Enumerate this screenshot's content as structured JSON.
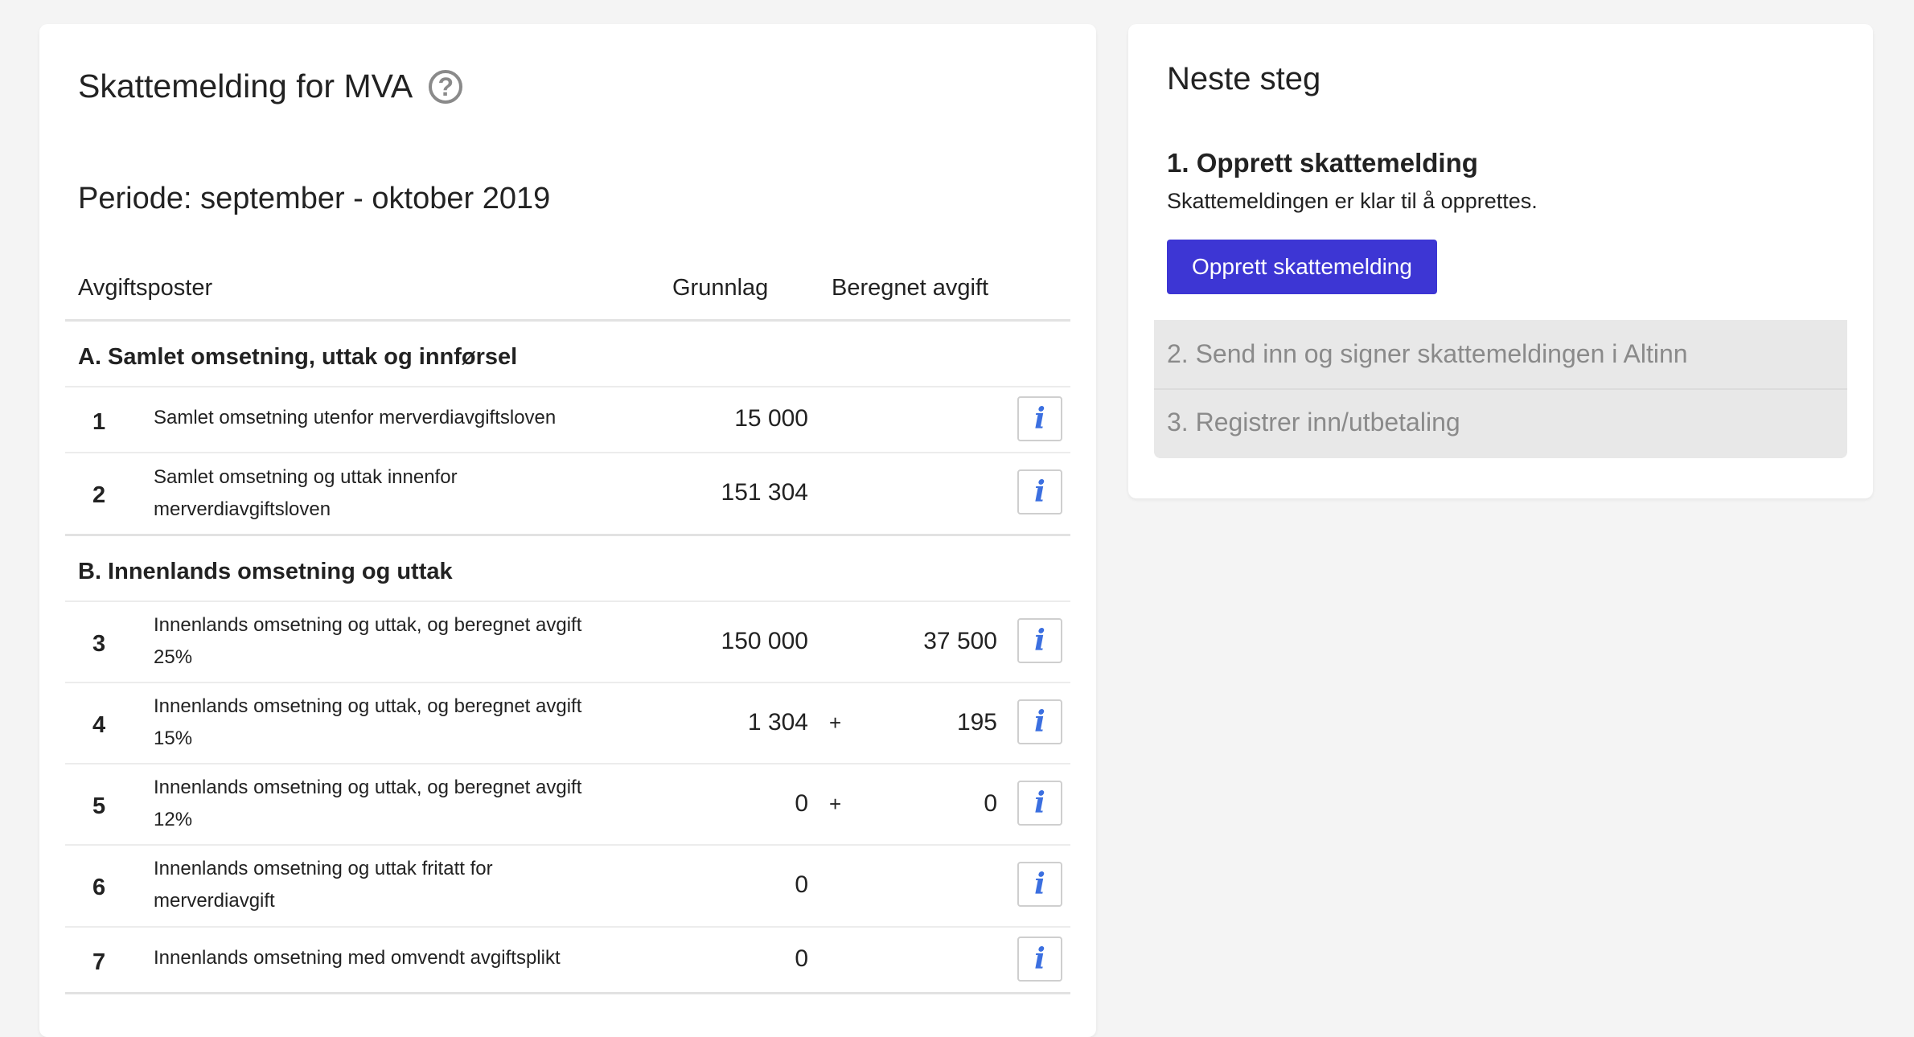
{
  "left": {
    "title": "Skattemelding for MVA",
    "help_icon": "question-circle-icon",
    "period": "Periode: september - oktober 2019",
    "headers": {
      "avgiftsposter": "Avgiftsposter",
      "grunnlag": "Grunnlag",
      "beregnet": "Beregnet avgift"
    },
    "section_a": "A. Samlet omsetning, uttak og innførsel",
    "section_b": "B. Innenlands omsetning og uttak",
    "rows": [
      {
        "num": "1",
        "desc": "Samlet omsetning utenfor merverdiavgiftsloven",
        "grunnlag": "15 000",
        "plus": "",
        "avgift": ""
      },
      {
        "num": "2",
        "desc": "Samlet omsetning og uttak innenfor merverdiavgiftsloven",
        "grunnlag": "151 304",
        "plus": "",
        "avgift": ""
      },
      {
        "num": "3",
        "desc": "Innenlands omsetning og uttak, og beregnet avgift 25%",
        "grunnlag": "150 000",
        "plus": "",
        "avgift": "37 500"
      },
      {
        "num": "4",
        "desc": "Innenlands omsetning og uttak, og beregnet avgift 15%",
        "grunnlag": "1 304",
        "plus": "+",
        "avgift": "195"
      },
      {
        "num": "5",
        "desc": "Innenlands omsetning og uttak, og beregnet avgift 12%",
        "grunnlag": "0",
        "plus": "+",
        "avgift": "0"
      },
      {
        "num": "6",
        "desc": "Innenlands omsetning og uttak fritatt for merverdiavgift",
        "grunnlag": "0",
        "plus": "",
        "avgift": ""
      },
      {
        "num": "7",
        "desc": "Innenlands omsetning med omvendt avgiftsplikt",
        "grunnlag": "0",
        "plus": "",
        "avgift": ""
      }
    ],
    "info_label": "i",
    "info_icon": "info-icon"
  },
  "right": {
    "title": "Neste steg",
    "step1_title": "1. Opprett skattemelding",
    "step1_desc": "Skattemeldingen er klar til å opprettes.",
    "step1_button": "Opprett skattemelding",
    "step2": "2. Send inn og signer skattemeldingen i Altinn",
    "step3": "3. Registrer inn/utbetaling"
  },
  "colors": {
    "primary_button": "#3d36d4",
    "info_icon": "#3b6fe0",
    "pending_step_bg": "#e8e8e8",
    "page_bg": "#f4f4f4"
  }
}
